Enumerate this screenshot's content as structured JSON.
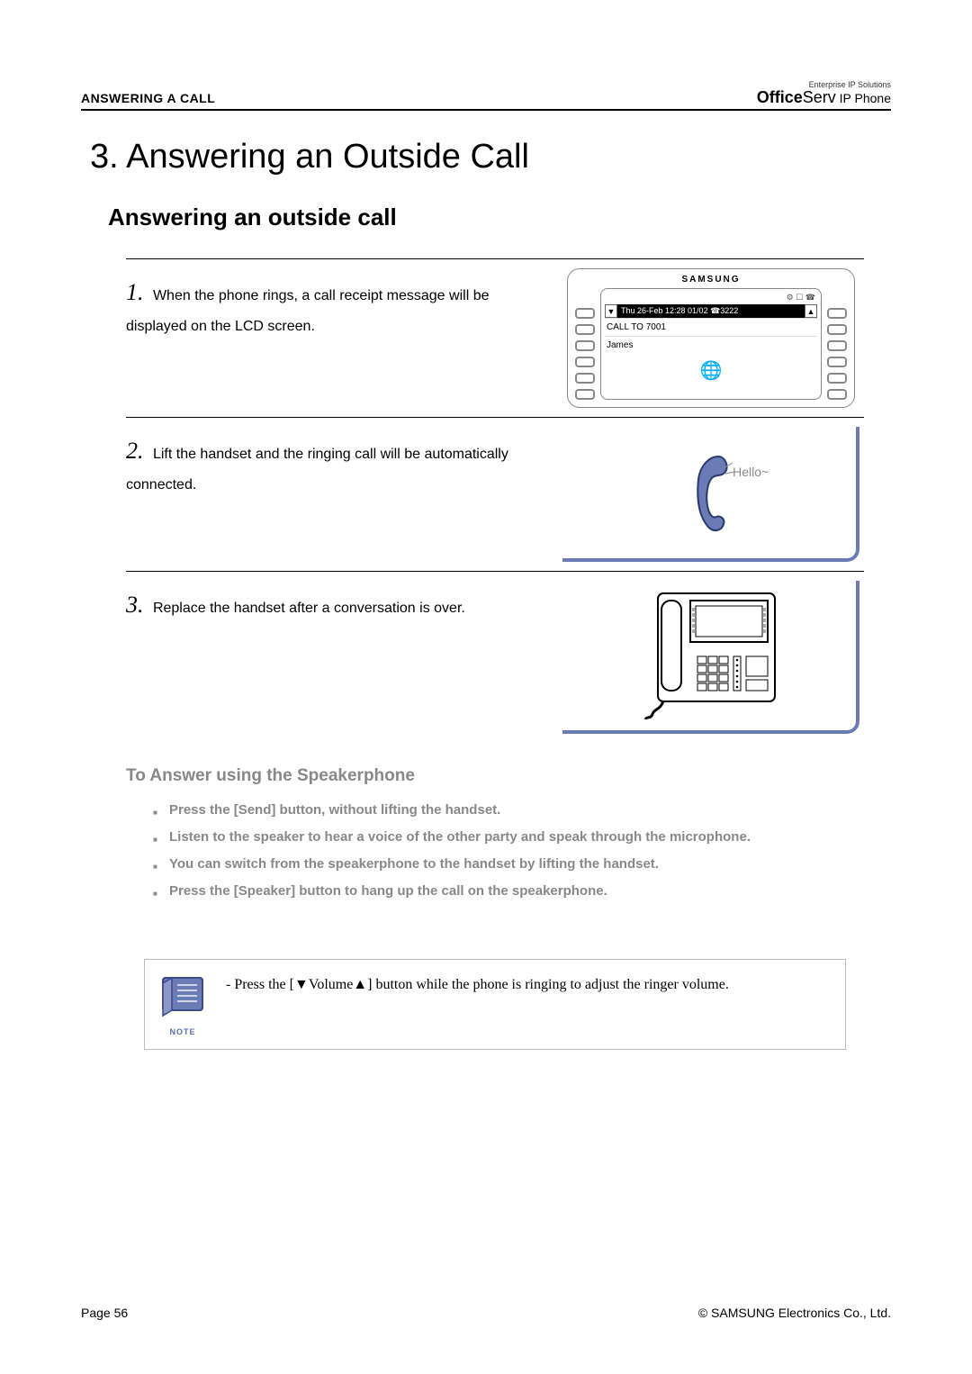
{
  "header": {
    "section": "ANSWERING A CALL",
    "brand_top": "Enterprise IP Solutions",
    "brand_bold": "Office",
    "brand_light": "Serv",
    "brand_suffix": " IP Phone"
  },
  "title": "3. Answering an Outside Call",
  "subtitle": "Answering an outside call",
  "steps": [
    {
      "num": "1.",
      "text": "When the phone rings, a call receipt message will be displayed on the LCD screen.",
      "lcd": {
        "brand": "SAMSUNG",
        "icons": "⚙ ☐ ☎",
        "title": "Thu 26-Feb 12:28 01/02 ☎3222",
        "line1": "CALL TO 7001",
        "line2": "James"
      }
    },
    {
      "num": "2.",
      "text": "Lift the handset and the ringing call will be automatically connected.",
      "hello": "Hello~"
    },
    {
      "num": "3.",
      "text": "Replace the handset after a conversation is over."
    }
  ],
  "subhead": "To Answer using the Speakerphone",
  "bullets": [
    "Press the [Send] button, without lifting the handset.",
    "Listen to the speaker to hear a voice of the other party and speak through the microphone.",
    "You can switch from the speakerphone to the handset by lifting the handset.",
    "Press the [Speaker] button to hang up the call on the speakerphone."
  ],
  "note": {
    "label": "NOTE",
    "text": "- Press the [▼Volume▲] button while the phone is ringing to adjust the ringer volume."
  },
  "footer": {
    "page": "Page 56",
    "copyright": "© SAMSUNG Electronics Co., Ltd."
  }
}
